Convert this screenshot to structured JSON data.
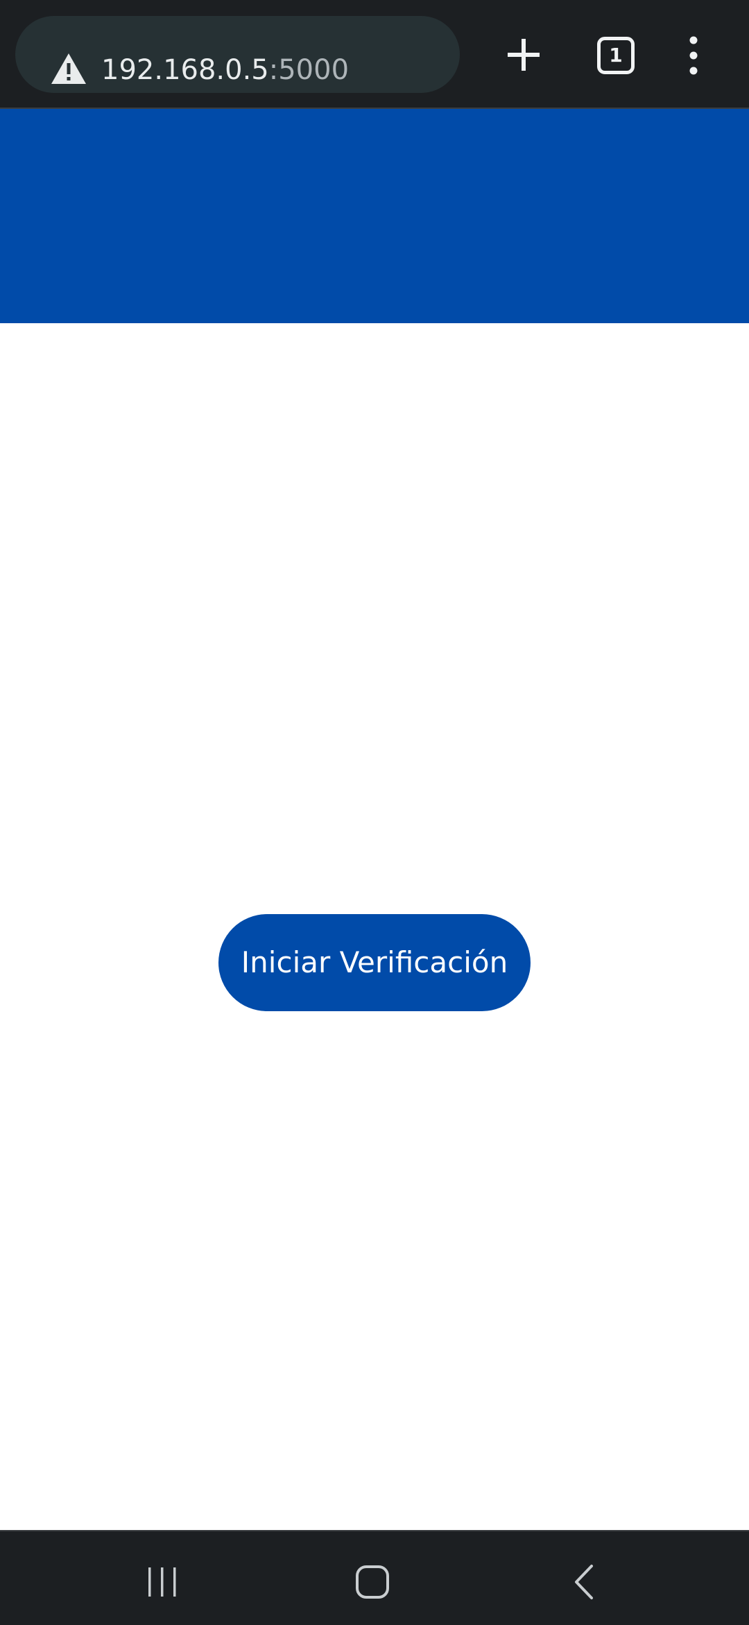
{
  "browser": {
    "url_host": "192.168.0.5",
    "url_port": ":5000",
    "tab_count": "1",
    "icons": {
      "security": "warning-triangle-icon",
      "new_tab": "plus-icon",
      "tabs": "tab-switcher-icon",
      "menu": "vertical-dots-icon"
    }
  },
  "page": {
    "header_color": "#014ba9",
    "start_button_label": "Iniciar Verificación"
  },
  "system_nav": {
    "icons": [
      "recent-apps-icon",
      "home-icon",
      "back-icon"
    ]
  }
}
